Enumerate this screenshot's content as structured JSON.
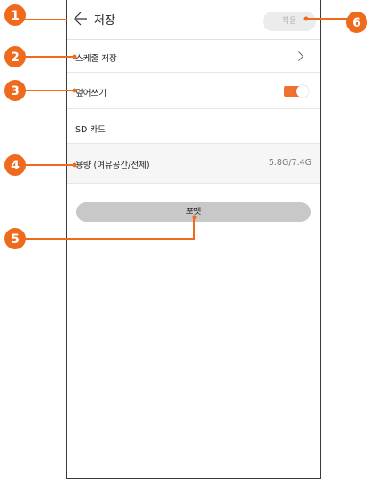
{
  "header": {
    "title": "저장",
    "apply_label": "적용"
  },
  "schedule_save": {
    "label": "스케줄 저장"
  },
  "overwrite": {
    "label": "덮어쓰기",
    "enabled": true
  },
  "sd_card": {
    "label": "SD 카드"
  },
  "capacity": {
    "label": "용량 (여유공간/전체)",
    "value": "5.8G/7.4G"
  },
  "format_button": {
    "label": "포맷"
  },
  "callouts": [
    "1",
    "2",
    "3",
    "4",
    "5",
    "6"
  ],
  "colors": {
    "accent": "#f07030",
    "callout": "#ee6a1c"
  }
}
